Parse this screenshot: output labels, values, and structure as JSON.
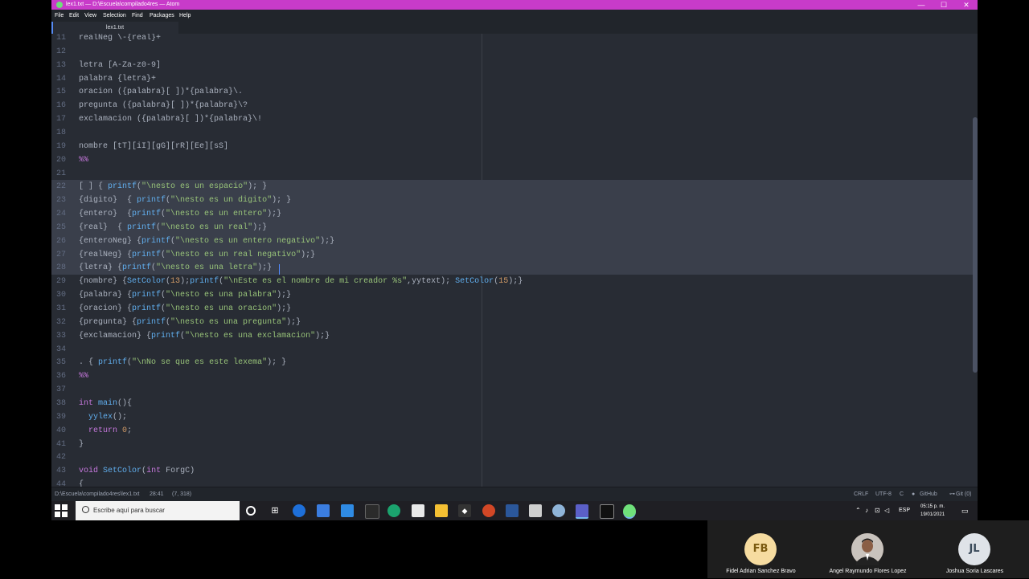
{
  "window": {
    "title": "lex1.txt — D:\\Escuela\\compilado4res — Atom",
    "controls": [
      "—",
      "☐",
      "✕"
    ]
  },
  "menu": {
    "items": [
      "File",
      "Edit",
      "View",
      "Selection",
      "Find",
      "Packages",
      "Help"
    ]
  },
  "tab": {
    "label": "lex1.txt"
  },
  "editor": {
    "selected_lines": [
      22,
      23,
      24,
      25,
      26,
      27,
      28
    ],
    "cursor_line": 28,
    "lines": [
      {
        "n": "11",
        "tokens": [
          [
            "w",
            "realNeg \\-{real}+"
          ]
        ]
      },
      {
        "n": "12",
        "tokens": []
      },
      {
        "n": "13",
        "tokens": [
          [
            "w",
            "letra [A-Za-z0-9]"
          ]
        ]
      },
      {
        "n": "14",
        "tokens": [
          [
            "w",
            "palabra {letra}+"
          ]
        ]
      },
      {
        "n": "15",
        "tokens": [
          [
            "w",
            "oracion ({palabra}[ ])*{palabra}\\."
          ]
        ]
      },
      {
        "n": "16",
        "tokens": [
          [
            "w",
            "pregunta ({palabra}[ ])*{palabra}\\?"
          ]
        ]
      },
      {
        "n": "17",
        "tokens": [
          [
            "w",
            "exclamacion ({palabra}[ ])*{palabra}\\!"
          ]
        ]
      },
      {
        "n": "18",
        "tokens": []
      },
      {
        "n": "19",
        "tokens": [
          [
            "w",
            "nombre [tT][iI][gG][rR][Ee][sS]"
          ]
        ]
      },
      {
        "n": "20",
        "tokens": [
          [
            "k",
            "%%"
          ]
        ]
      },
      {
        "n": "21",
        "tokens": []
      },
      {
        "n": "22",
        "tokens": [
          [
            "w",
            "[ ] { "
          ],
          [
            "b",
            "printf"
          ],
          [
            "w",
            "("
          ],
          [
            "g",
            "\"\\nesto es un espacio\""
          ],
          [
            "w",
            "); }"
          ]
        ]
      },
      {
        "n": "23",
        "tokens": [
          [
            "w",
            "{digito}  { "
          ],
          [
            "b",
            "printf"
          ],
          [
            "w",
            "("
          ],
          [
            "g",
            "\"\\nesto es un digito\""
          ],
          [
            "w",
            "); }"
          ]
        ]
      },
      {
        "n": "24",
        "tokens": [
          [
            "w",
            "{entero}  {"
          ],
          [
            "b",
            "printf"
          ],
          [
            "w",
            "("
          ],
          [
            "g",
            "\"\\nesto es un entero\""
          ],
          [
            "w",
            ");}"
          ]
        ]
      },
      {
        "n": "25",
        "tokens": [
          [
            "w",
            "{real}  { "
          ],
          [
            "b",
            "printf"
          ],
          [
            "w",
            "("
          ],
          [
            "g",
            "\"\\nesto es un real\""
          ],
          [
            "w",
            ");}"
          ]
        ]
      },
      {
        "n": "26",
        "tokens": [
          [
            "w",
            "{enteroNeg} {"
          ],
          [
            "b",
            "printf"
          ],
          [
            "w",
            "("
          ],
          [
            "g",
            "\"\\nesto es un entero negativo\""
          ],
          [
            "w",
            ");}"
          ]
        ]
      },
      {
        "n": "27",
        "tokens": [
          [
            "w",
            "{realNeg} {"
          ],
          [
            "b",
            "printf"
          ],
          [
            "w",
            "("
          ],
          [
            "g",
            "\"\\nesto es un real negativo\""
          ],
          [
            "w",
            ");}"
          ]
        ]
      },
      {
        "n": "28",
        "tokens": [
          [
            "w",
            "{letra} {"
          ],
          [
            "b",
            "printf"
          ],
          [
            "w",
            "("
          ],
          [
            "g",
            "\"\\nesto es una letra\""
          ],
          [
            "w",
            ");}"
          ]
        ]
      },
      {
        "n": "29",
        "tokens": [
          [
            "w",
            "{nombre} {"
          ],
          [
            "b",
            "SetColor"
          ],
          [
            "w",
            "("
          ],
          [
            "o",
            "13"
          ],
          [
            "w",
            ");"
          ],
          [
            "b",
            "printf"
          ],
          [
            "w",
            "("
          ],
          [
            "g",
            "\"\\nEste es el nombre de mi creador %s\""
          ],
          [
            "w",
            ",yytext); "
          ],
          [
            "b",
            "SetColor"
          ],
          [
            "w",
            "("
          ],
          [
            "o",
            "15"
          ],
          [
            "w",
            ");}"
          ]
        ]
      },
      {
        "n": "30",
        "tokens": [
          [
            "w",
            "{palabra} {"
          ],
          [
            "b",
            "printf"
          ],
          [
            "w",
            "("
          ],
          [
            "g",
            "\"\\nesto es una palabra\""
          ],
          [
            "w",
            ");}"
          ]
        ]
      },
      {
        "n": "31",
        "tokens": [
          [
            "w",
            "{oracion} {"
          ],
          [
            "b",
            "printf"
          ],
          [
            "w",
            "("
          ],
          [
            "g",
            "\"\\nesto es una oracion\""
          ],
          [
            "w",
            ");}"
          ]
        ]
      },
      {
        "n": "32",
        "tokens": [
          [
            "w",
            "{pregunta} {"
          ],
          [
            "b",
            "printf"
          ],
          [
            "w",
            "("
          ],
          [
            "g",
            "\"\\nesto es una pregunta\""
          ],
          [
            "w",
            ");}"
          ]
        ]
      },
      {
        "n": "33",
        "tokens": [
          [
            "w",
            "{exclamacion} {"
          ],
          [
            "b",
            "printf"
          ],
          [
            "w",
            "("
          ],
          [
            "g",
            "\"\\nesto es una exclamacion\""
          ],
          [
            "w",
            ");}"
          ]
        ]
      },
      {
        "n": "34",
        "tokens": []
      },
      {
        "n": "35",
        "tokens": [
          [
            "w",
            ". { "
          ],
          [
            "b",
            "printf"
          ],
          [
            "w",
            "("
          ],
          [
            "g",
            "\"\\nNo se que es este lexema\""
          ],
          [
            "w",
            "); }"
          ]
        ]
      },
      {
        "n": "36",
        "tokens": [
          [
            "k",
            "%%"
          ]
        ]
      },
      {
        "n": "37",
        "tokens": []
      },
      {
        "n": "38",
        "tokens": [
          [
            "k",
            "int"
          ],
          [
            "w",
            " "
          ],
          [
            "b",
            "main"
          ],
          [
            "w",
            "(){"
          ]
        ]
      },
      {
        "n": "39",
        "tokens": [
          [
            "w",
            "  "
          ],
          [
            "b",
            "yylex"
          ],
          [
            "w",
            "();"
          ]
        ]
      },
      {
        "n": "40",
        "tokens": [
          [
            "w",
            "  "
          ],
          [
            "k",
            "return"
          ],
          [
            "w",
            " "
          ],
          [
            "o",
            "0"
          ],
          [
            "w",
            ";"
          ]
        ]
      },
      {
        "n": "41",
        "tokens": [
          [
            "w",
            "}"
          ]
        ]
      },
      {
        "n": "42",
        "tokens": []
      },
      {
        "n": "43",
        "tokens": [
          [
            "k",
            "void"
          ],
          [
            "w",
            " "
          ],
          [
            "b",
            "SetColor"
          ],
          [
            "w",
            "("
          ],
          [
            "k",
            "int"
          ],
          [
            "w",
            " ForgC)"
          ]
        ]
      },
      {
        "n": "44",
        "tokens": [
          [
            "w",
            "{"
          ]
        ]
      }
    ]
  },
  "status": {
    "path": "D:\\Escuela\\compilado4res\\lex1.txt",
    "cursor_pos": "28:41",
    "selection": "(7, 318)",
    "line_ending": "CRLF",
    "encoding": "UTF-8",
    "grammar": "C",
    "github": "GitHub",
    "git": "Git (0)"
  },
  "taskbar": {
    "search_placeholder": "Escribe aquí para buscar",
    "lang": "ESP",
    "time": "05:15 p. m.",
    "date": "19/01/2021"
  },
  "participants": [
    {
      "initials": "FB",
      "name": "Fidel Adrian Sanchez Bravo",
      "color": "#f6dca0",
      "text_color": "#7a5a10"
    },
    {
      "initials": "",
      "name": "Angel Raymundo Flores Lopez",
      "color": "#8a6a5a",
      "text_color": "#ffffff"
    },
    {
      "initials": "JL",
      "name": "Joshua Soria Lascares",
      "color": "#dfe3e8",
      "text_color": "#3a4a5a"
    }
  ],
  "colors": {
    "title_bar": "#c83bc9",
    "editor_bg": "#282c34",
    "syntax_red": "#e06c75",
    "syntax_green": "#98c379",
    "syntax_blue": "#61afef",
    "syntax_purple": "#c678dd",
    "syntax_orange": "#d19a66"
  }
}
